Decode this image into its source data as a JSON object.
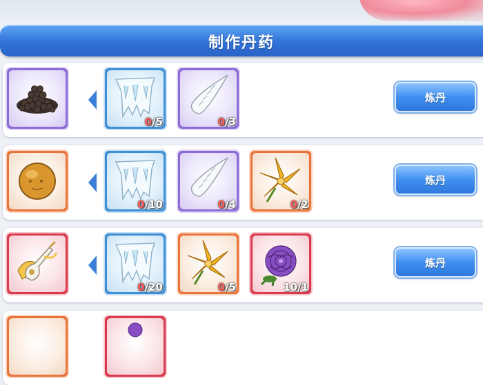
{
  "header": {
    "title": "制作丹药"
  },
  "recipes": [
    {
      "button_label": "炼丹",
      "product": {
        "name": "black-pills-icon",
        "rarity": "purple"
      },
      "ingredients": [
        {
          "icon": "ice-crystal-icon",
          "rarity": "blue",
          "have": "0",
          "need": "/5"
        },
        {
          "icon": "white-horn-icon",
          "rarity": "purple",
          "have": "0",
          "need": "/3"
        }
      ]
    },
    {
      "button_label": "炼丹",
      "product": {
        "name": "golden-pill-icon",
        "rarity": "orange"
      },
      "ingredients": [
        {
          "icon": "ice-crystal-icon",
          "rarity": "blue",
          "have": "0",
          "need": "/10"
        },
        {
          "icon": "white-horn-icon",
          "rarity": "purple",
          "have": "0",
          "need": "/4"
        },
        {
          "icon": "golden-lily-icon",
          "rarity": "orange",
          "have": "0",
          "need": "/2"
        }
      ]
    },
    {
      "button_label": "炼丹",
      "product": {
        "name": "jade-pipa-icon",
        "rarity": "red"
      },
      "ingredients": [
        {
          "icon": "ice-crystal-icon",
          "rarity": "blue",
          "have": "0",
          "need": "/20"
        },
        {
          "icon": "golden-lily-icon",
          "rarity": "orange",
          "have": "0",
          "need": "/5"
        },
        {
          "icon": "purple-peony-icon",
          "rarity": "red",
          "have": "10",
          "need": "/1"
        }
      ]
    },
    {
      "product": {
        "name": "item-icon",
        "rarity": "orange"
      },
      "ingredients": [
        {
          "icon": "item-icon",
          "rarity": "red"
        }
      ]
    }
  ]
}
